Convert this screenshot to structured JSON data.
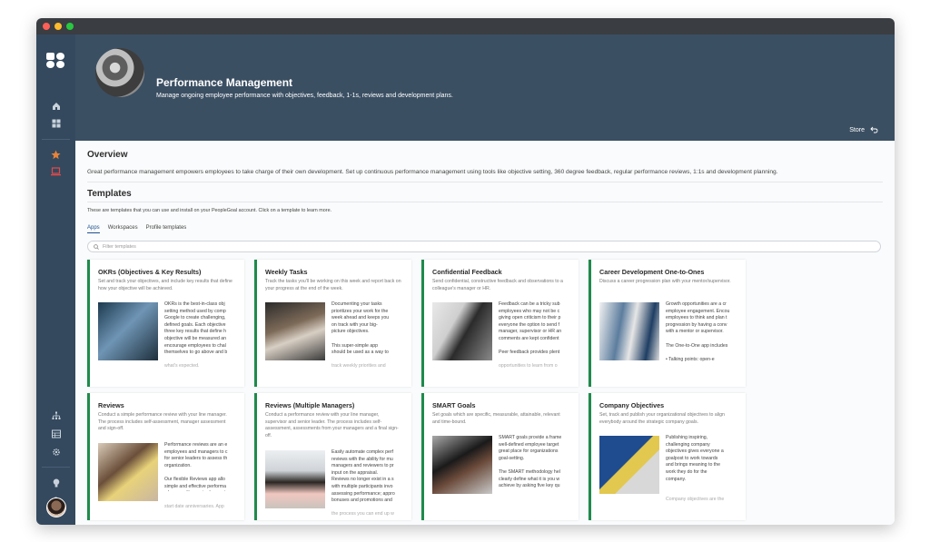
{
  "header": {
    "title": "Performance Management",
    "subtitle": "Manage ongoing employee performance with objectives, feedback, 1-1s, reviews and development plans.",
    "store_label": "Store"
  },
  "overview": {
    "title": "Overview",
    "text": "Great performance management empowers employees to take charge of their own development. Set up continuous performance management using tools like objective setting, 360 degree feedback, regular performance reviews, 1:1s and development planning."
  },
  "templates": {
    "title": "Templates",
    "description": "These are templates that you can use and install on your PeopleGoal account. Click on a template to learn more.",
    "tabs": [
      "Apps",
      "Workspaces",
      "Profile templates"
    ],
    "filter_placeholder": "Filter templates"
  },
  "cards": [
    {
      "title": "OKRs (Objectives & Key Results)",
      "desc": "Set and track your objectives, and include key results that define how your objective will be achieved.",
      "body": "OKRs is the best-in-class obj\nsetting method used by comp\nGoogle to create challenging,\ndefined goals. Each objective\nthree key results that define h\nobjective will be measured an\nencourage employees to chal\nthemselves to go above and b",
      "fade": "what's expected."
    },
    {
      "title": "Weekly Tasks",
      "desc": "Track the tasks you'll be working on this week and report back on your progress at the end of the week.",
      "body": "Documenting your tasks\nprioritizes your work for the\nweek ahead and keeps you\non track with your big-\npicture objectives.\n\nThis super-simple app\nshould be used as a way to",
      "fade": "track weekly priorities and"
    },
    {
      "title": "Confidential Feedback",
      "desc": "Send confidential, constructive feedback and observations to a colleague's manager or HR.",
      "body": "Feedback can be a tricky sub\nemployees who may not be c\ngiving open criticism to their p\neveryone the option to send f\nmanager, supervisor or HR an\ncomments are kept confident\n\nPeer feedback provides plent",
      "fade": "opportunities to learn from o"
    },
    {
      "title": "Career Development One-to-Ones",
      "desc": "Discuss a career progression plan with your mentor/supervisor.",
      "body": "Growth opportunities are a cr\nemployee engagement. Encou\nemployees to think and plan t\nprogression by having a conv\nwith a mentor or supervisor.\n\nThe One-to-One app includes\n\n  •  Talking points: open-e",
      "fade": ""
    },
    {
      "title": "Reviews",
      "desc": "Conduct a simple performance review with your line manager. The process includes self-assessment, manager assessment and sign-off.",
      "body": "Performance reviews are an e\nemployees and managers to c\nfor senior leaders to assess th\norganization.\n\nOur flexible Reviews app allo\nsimple and effective performa\nwhenever it's required - quart",
      "fade": "start date anniversaries. App"
    },
    {
      "title": "Reviews (Multiple Managers)",
      "desc": "Conduct a performance review with your line manager, supervisor and senior leader. The process includes self-assessment, assessments from your managers and a final sign-off.",
      "body": "Easily automate complex perf\nreviews with the ability for mu\nmanagers and reviewers to pr\ninput on the appraisal.\nReviews no longer exist in a s\nwith multiple participants invo\nassessing performance; appro\nbonuses and promotions and",
      "fade": "the process you can end up w"
    },
    {
      "title": "SMART Goals",
      "desc": "Set goals which are specific, measurable, attainable, relevant and time-bound.",
      "body": "SMART goals provide a frame\nwell-defined employee target\ngreat place for organizations\ngoal-setting.\n\nThe SMART methodology hel\nclearly define what it is you w\nachieve by asking five key qu",
      "fade": ""
    },
    {
      "title": "Company Objectives",
      "desc": "Set, track and publish your organizational objectives to align everybody around the strategic company goals.",
      "body": "Publishing inspiring,\nchallenging company\nobjectives gives everyone a\ngoalpost to work towards\nand brings meaning to the\nwork they do for the\ncompany.\n",
      "fade": "Company objectives are the"
    }
  ],
  "colors": {
    "sidebar": "#34495e",
    "header": "#3b4f63",
    "card_accent": "#1e8a4c",
    "star": "#e8833a",
    "active_tab": "#1f4f8f"
  }
}
